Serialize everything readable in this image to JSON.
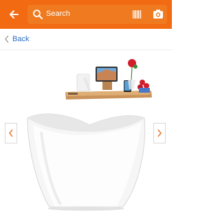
{
  "header": {
    "back_icon": "back-arrow-icon",
    "search_placeholder": "Search",
    "search_icon": "search-icon",
    "barcode_icon": "barcode-scan-icon",
    "camera_icon": "camera-icon",
    "accent_color": "#f26a12"
  },
  "nav": {
    "back_label": "Back",
    "back_icon": "chevron-left-icon"
  },
  "product": {
    "image_icon": "bathtub-with-caddy-tray",
    "prev_icon": "chevron-left-icon",
    "next_icon": "chevron-right-icon"
  }
}
